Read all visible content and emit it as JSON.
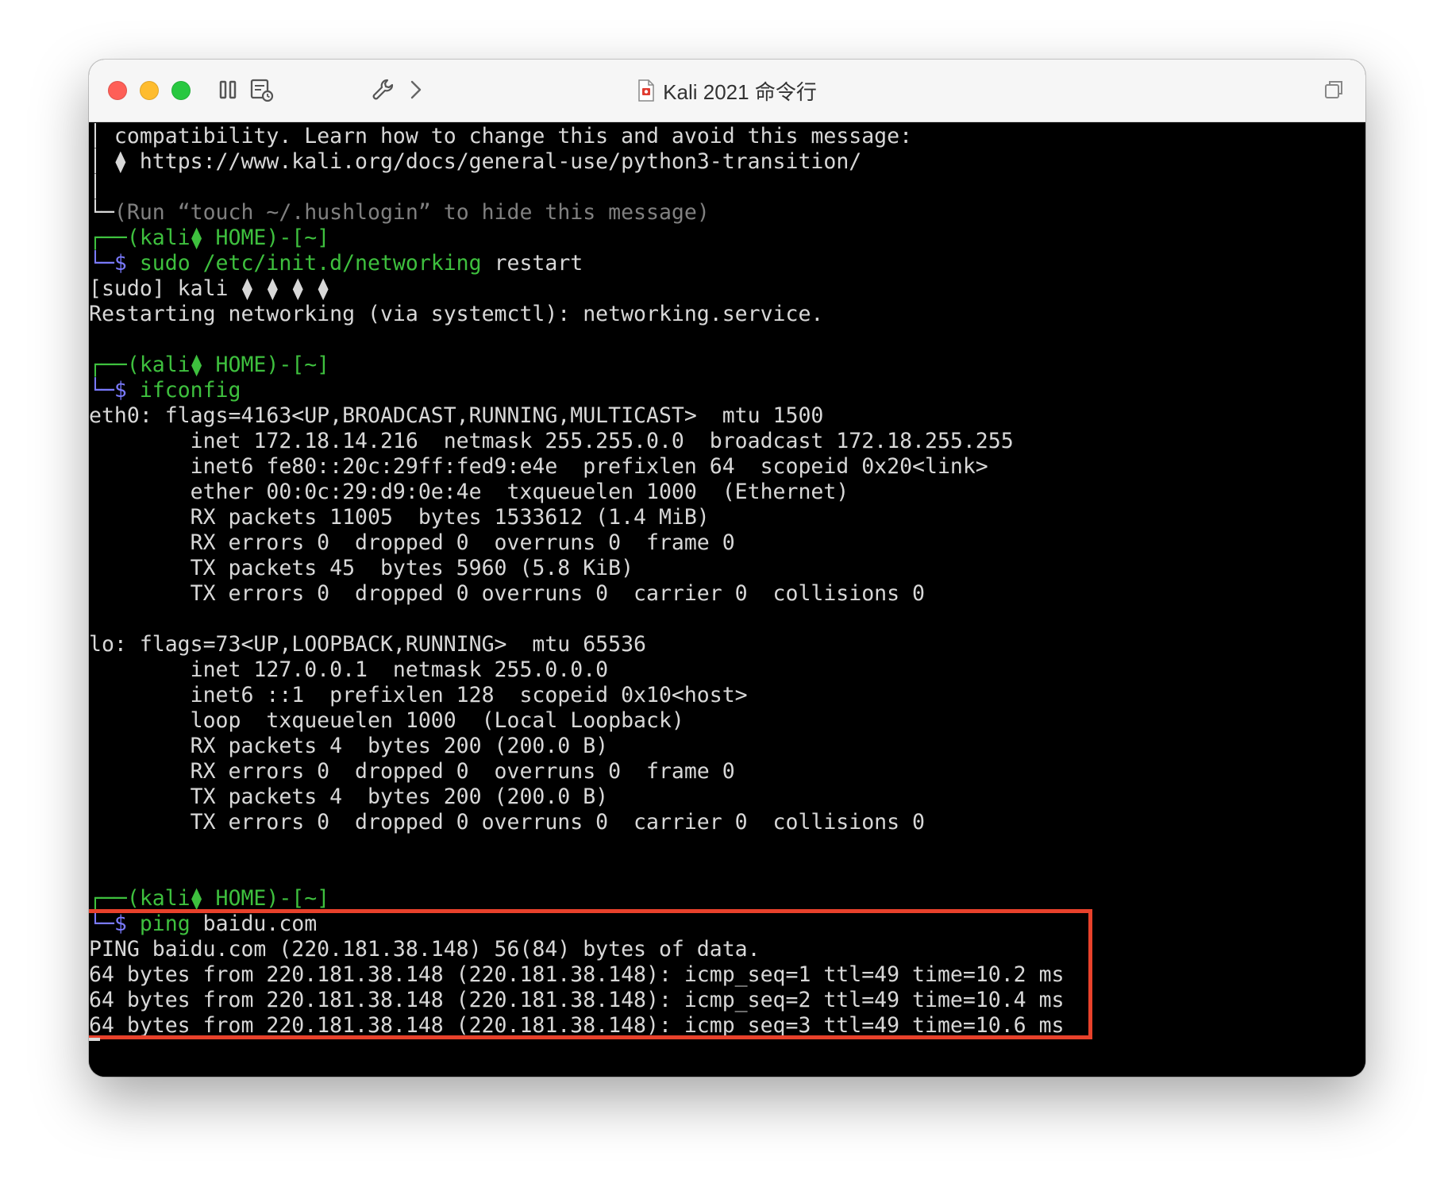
{
  "window": {
    "title": "Kali 2021 命令行",
    "icons": [
      "sidebar-toggle-icon",
      "snapshot-icon",
      "wrench-icon",
      "chevron-right-icon",
      "restore-window-icon",
      "document-icon"
    ],
    "highlight_color": "#e8412b"
  },
  "terminal": {
    "lines": [
      {
        "prefix": "│ ",
        "text": "compatibility. Learn how to change this and avoid this message:"
      },
      {
        "prefix": "│ ",
        "text": "⧫ https://www.kali.org/docs/general-use/python3-transition/"
      },
      {
        "prefix": "│",
        "text": ""
      },
      {
        "prefix": "└─",
        "text": "(Run “touch ~/.hushlogin” to hide this message)"
      },
      {
        "prompt": "┌──(kali⧫ HOME)-[~]"
      },
      {
        "cmd_prefix": "└─$ ",
        "cmd": "sudo /etc/init.d/networking",
        "args": " restart"
      },
      {
        "text": "[sudo] kali ⧫ ⧫ ⧫ ⧫"
      },
      {
        "text": "Restarting networking (via systemctl): networking.service."
      },
      {
        "prompt": "┌──(kali⧫ HOME)-[~]"
      },
      {
        "cmd_prefix": "└─$ ",
        "cmd": "ifconfig"
      },
      {
        "text": "eth0: flags=4163<UP,BROADCAST,RUNNING,MULTICAST>  mtu 1500"
      },
      {
        "text": "        inet 172.18.14.216  netmask 255.255.0.0  broadcast 172.18.255.255"
      },
      {
        "text": "        inet6 fe80::20c:29ff:fed9:e4e  prefixlen 64  scopeid 0x20<link>"
      },
      {
        "text": "        ether 00:0c:29:d9:0e:4e  txqueuelen 1000  (Ethernet)"
      },
      {
        "text": "        RX packets 11005  bytes 1533612 (1.4 MiB)"
      },
      {
        "text": "        RX errors 0  dropped 0  overruns 0  frame 0"
      },
      {
        "text": "        TX packets 45  bytes 5960 (5.8 KiB)"
      },
      {
        "text": "        TX errors 0  dropped 0 overruns 0  carrier 0  collisions 0"
      },
      {
        "text": "lo: flags=73<UP,LOOPBACK,RUNNING>  mtu 65536"
      },
      {
        "text": "        inet 127.0.0.1  netmask 255.0.0.0"
      },
      {
        "text": "        inet6 ::1  prefixlen 128  scopeid 0x10<host>"
      },
      {
        "text": "        loop  txqueuelen 1000  (Local Loopback)"
      },
      {
        "text": "        RX packets 4  bytes 200 (200.0 B)"
      },
      {
        "text": "        RX errors 0  dropped 0  overruns 0  frame 0"
      },
      {
        "text": "        TX packets 4  bytes 200 (200.0 B)"
      },
      {
        "text": "        TX errors 0  dropped 0 overruns 0  carrier 0  collisions 0"
      },
      {
        "prompt": "┌──(kali⧫ HOME)-[~]"
      },
      {
        "cmd_prefix": "└─$ ",
        "cmd": "ping",
        "args": " baidu.com"
      },
      {
        "text": "PING baidu.com (220.181.38.148) 56(84) bytes of data."
      },
      {
        "text": "64 bytes from 220.181.38.148 (220.181.38.148): icmp_seq=1 ttl=49 time=10.2 ms"
      },
      {
        "text": "64 bytes from 220.181.38.148 (220.181.38.148): icmp_seq=2 ttl=49 time=10.4 ms"
      },
      {
        "text": "64 bytes from 220.181.38.148 (220.181.38.148): icmp_seq=3 ttl=49 time=10.6 ms"
      }
    ]
  }
}
